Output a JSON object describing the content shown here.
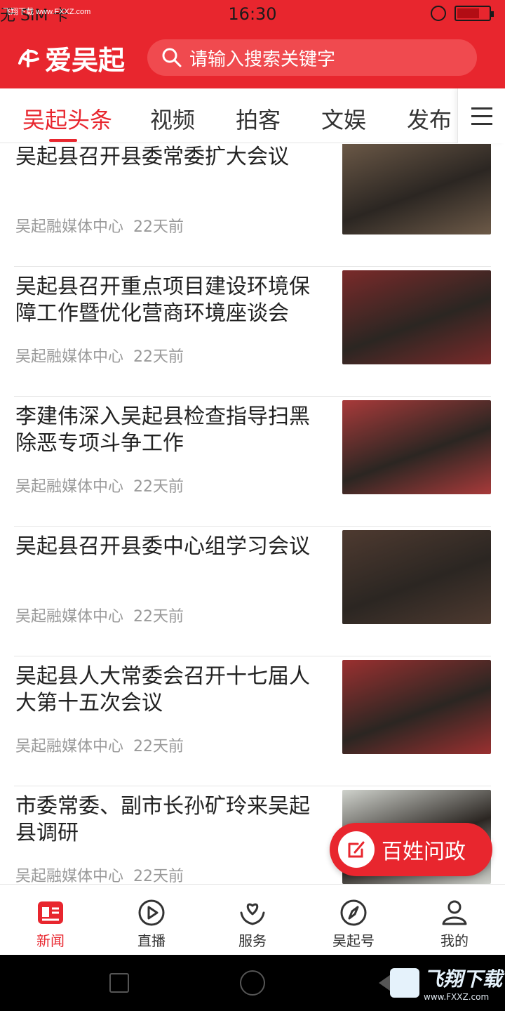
{
  "status_bar": {
    "watermark": "飞翔下载 www.FXXZ.com",
    "carrier": "无 SIM 卡",
    "time": "16:30",
    "battery_level": 0.7
  },
  "header": {
    "app_name": "爱吴起",
    "search_placeholder": "请输入搜索关键字"
  },
  "tabs": [
    {
      "label": "吴起头条",
      "active": true
    },
    {
      "label": "视频",
      "active": false
    },
    {
      "label": "拍客",
      "active": false
    },
    {
      "label": "文娱",
      "active": false
    },
    {
      "label": "发布",
      "active": false
    }
  ],
  "news": [
    {
      "title": "吴起县召开县委常委扩大会议",
      "source": "吴起融媒体中心",
      "time": "22天前",
      "thumb_color": "#6d5a48"
    },
    {
      "title": "吴起县召开重点项目建设环境保障工作暨优化营商环境座谈会",
      "source": "吴起融媒体中心",
      "time": "22天前",
      "thumb_color": "#7a2a2a"
    },
    {
      "title": "李建伟深入吴起县检查指导扫黑除恶专项斗争工作",
      "source": "吴起融媒体中心",
      "time": "22天前",
      "thumb_color": "#a83a3a"
    },
    {
      "title": "吴起县召开县委中心组学习会议",
      "source": "吴起融媒体中心",
      "time": "22天前",
      "thumb_color": "#4e3a30"
    },
    {
      "title": "吴起县人大常委会召开十七届人大第十五次会议",
      "source": "吴起融媒体中心",
      "time": "22天前",
      "thumb_color": "#9a3030"
    },
    {
      "title": "市委常委、副市长孙矿玲来吴起县调研",
      "source": "吴起融媒体中心",
      "time": "22天前",
      "thumb_color": "#cfd2cc"
    }
  ],
  "fab": {
    "label": "百姓问政"
  },
  "bottom_nav": [
    {
      "label": "新闻",
      "icon": "news-icon",
      "active": true
    },
    {
      "label": "直播",
      "icon": "play-icon",
      "active": false
    },
    {
      "label": "服务",
      "icon": "service-heart-icon",
      "active": false
    },
    {
      "label": "吴起号",
      "icon": "compass-icon",
      "active": false
    },
    {
      "label": "我的",
      "icon": "user-icon",
      "active": false
    }
  ],
  "system_watermark": {
    "main": "飞翔下载",
    "sub": "www.FXXZ.com"
  },
  "colors": {
    "brand_red": "#e8262e",
    "text": "#222222",
    "meta": "#999999"
  }
}
